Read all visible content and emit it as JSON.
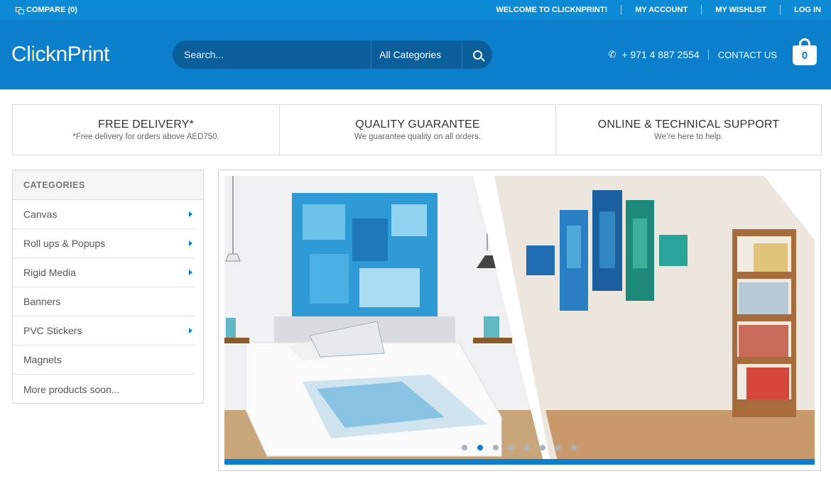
{
  "topbar": {
    "compare": "COMPARE (0)",
    "links": [
      "WELCOME TO CLICKNPRINT!",
      "MY ACCOUNT",
      "MY WISHLIST",
      "LOG IN"
    ]
  },
  "header": {
    "logo": {
      "part1": "Cl",
      "accent": "i",
      "part2": "cknPrint"
    },
    "search": {
      "placeholder": "Search...",
      "category": "All Categories"
    },
    "phone": "+ 971 4 887 2554",
    "contact": "CONTACT US",
    "cart_count": "0"
  },
  "features": [
    {
      "title": "FREE DELIVERY*",
      "subtitle": "*Free delivery for orders above AED750."
    },
    {
      "title": "QUALITY GUARANTEE",
      "subtitle": "We guarantee quality on all orders."
    },
    {
      "title": "ONLINE & TECHNICAL SUPPORT",
      "subtitle": "We’re here to help."
    }
  ],
  "categories": {
    "heading": "CATEGORIES",
    "items": [
      {
        "label": "Canvas",
        "has_sub": true
      },
      {
        "label": "Roll ups & Popups",
        "has_sub": true
      },
      {
        "label": "Rigid Media",
        "has_sub": true
      },
      {
        "label": "Banners",
        "has_sub": false
      },
      {
        "label": "PVC Stickers",
        "has_sub": true
      },
      {
        "label": "Magnets",
        "has_sub": false
      },
      {
        "label": "More products soon...",
        "has_sub": false
      }
    ]
  },
  "slider": {
    "slide_count": 8,
    "active_slide": 2
  },
  "colors": {
    "topbar": "#0d8ad6",
    "header": "#0b7fcb",
    "accent": "#ffd54a",
    "search_bg": "#0a5e99"
  }
}
